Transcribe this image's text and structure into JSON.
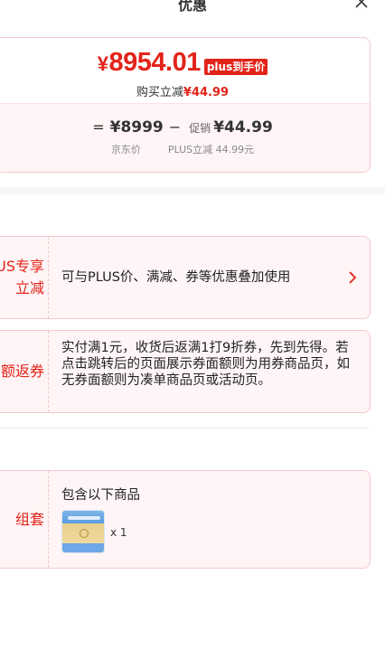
{
  "header": {
    "title": "优惠"
  },
  "price": {
    "currency": "¥",
    "final": "8954.01",
    "badge": "plus到手价",
    "save_prefix": "购买立减",
    "save_amount": "¥44.99",
    "formula": {
      "eq": "=",
      "jd_price": "¥8999",
      "minus": "−",
      "promo_word": "促销",
      "promo_amount": "¥44.99",
      "jd_label": "京东价",
      "plus_label": "PLUS立减 44.99元"
    }
  },
  "promos": [
    {
      "label": "US专享\n立减",
      "desc": "可与PLUS价、满减、券等优惠叠加使用"
    },
    {
      "label": "额返券",
      "desc": "实付满1元，收货后返满1打9折券，先到先得。若点击跳转后的页面展示券面额则为用券商品页，如无券面额则为凑单商品页或活动页。"
    },
    {
      "label": "组套",
      "desc": "包含以下商品",
      "qty": "x 1"
    }
  ],
  "icons": {
    "close": "close-icon",
    "chevron": "chevron-right-icon"
  },
  "colors": {
    "accent": "#e2231a",
    "card_border": "#f5c9cd",
    "card_bg": "#fff5f6"
  }
}
